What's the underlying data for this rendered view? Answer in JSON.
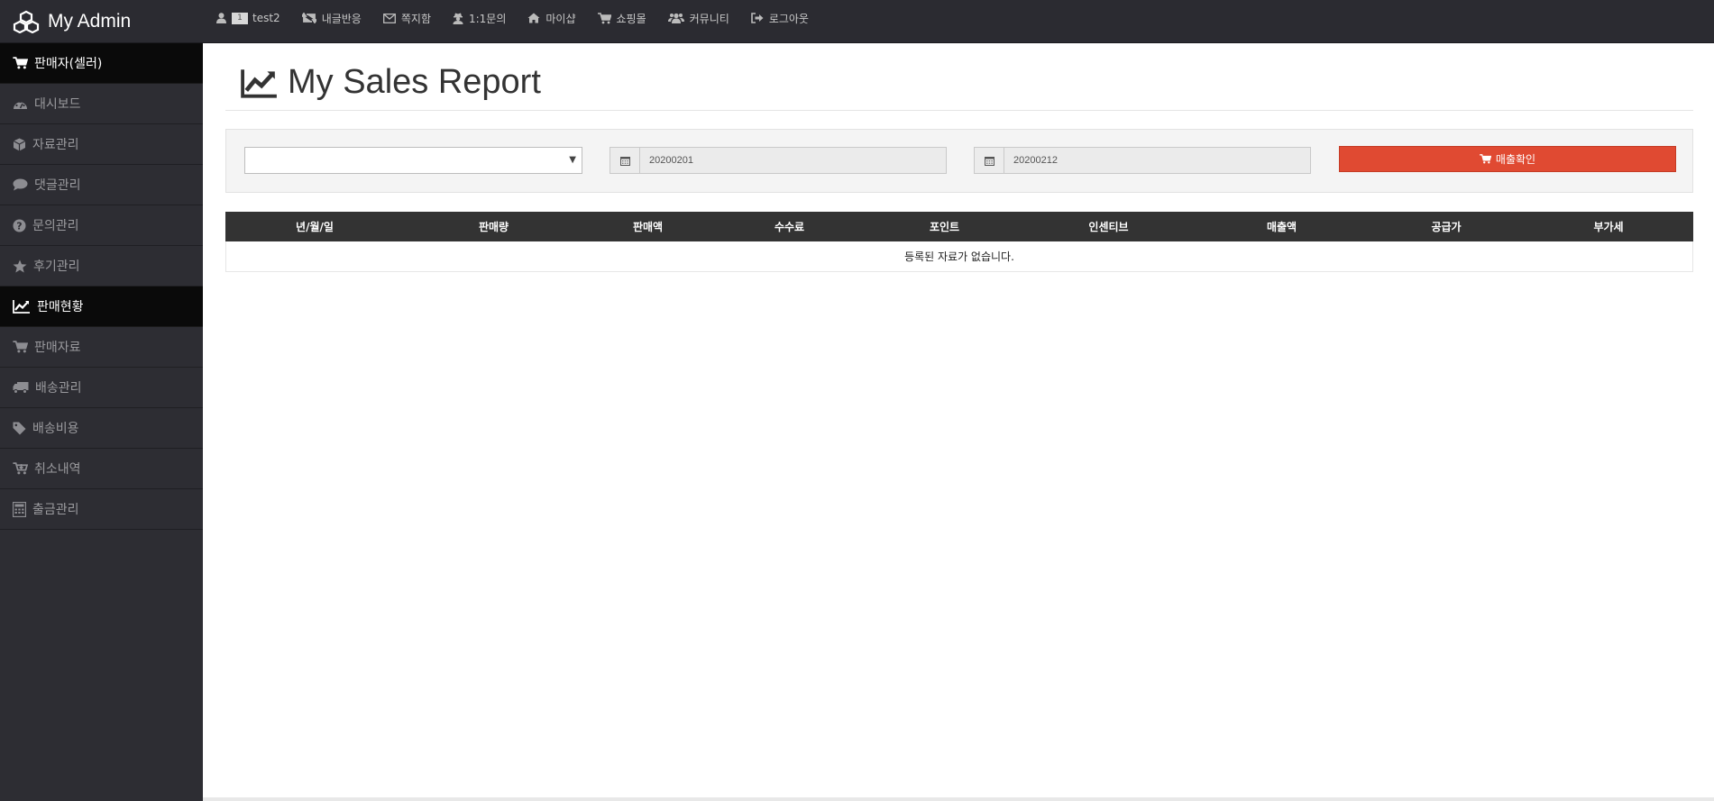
{
  "brand": {
    "title": "My Admin",
    "icon": "cubes-icon"
  },
  "topnav": {
    "user_badge": "1",
    "user_name": "test2",
    "items": [
      {
        "label": "내글반응",
        "icon": "retweet-icon"
      },
      {
        "label": "쪽지함",
        "icon": "envelope-icon"
      },
      {
        "label": "1:1문의",
        "icon": "user-secret-icon"
      },
      {
        "label": "마이샵",
        "icon": "home-icon"
      },
      {
        "label": "쇼핑몰",
        "icon": "cart-icon"
      },
      {
        "label": "커뮤니티",
        "icon": "users-icon"
      },
      {
        "label": "로그아웃",
        "icon": "sign-out-icon"
      }
    ]
  },
  "sidebar": {
    "section1": "판매자(셀러)",
    "items1": [
      "대시보드",
      "자료관리",
      "댓글관리",
      "문의관리",
      "후기관리"
    ],
    "section2": "판매현황",
    "items2": [
      "판매자료",
      "배송관리",
      "배송비용",
      "취소내역",
      "출금관리"
    ]
  },
  "page": {
    "title": "My Sales Report"
  },
  "filter": {
    "select_value": "",
    "date_from": "20200201",
    "date_to": "20200212",
    "button_label": "매출확인"
  },
  "table": {
    "headers": [
      "년/월/일",
      "판매량",
      "판매액",
      "수수료",
      "포인트",
      "인센티브",
      "매출액",
      "공급가",
      "부가세"
    ],
    "empty_message": "등록된 자료가 없습니다."
  },
  "colors": {
    "topbar": "#2b2b31",
    "sidebar": "#2d2d33",
    "accent": "#e04a32",
    "table_header": "#333333"
  }
}
